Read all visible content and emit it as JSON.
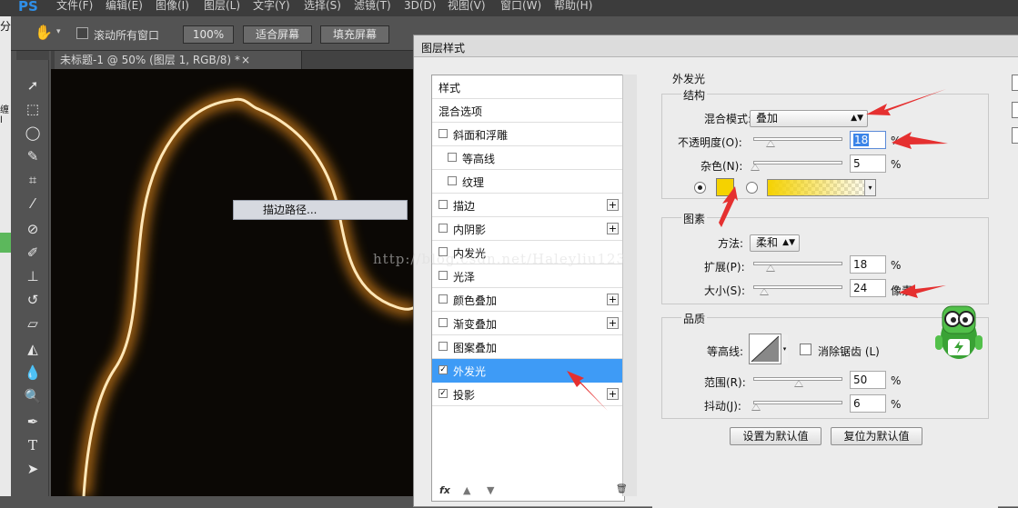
{
  "app": {
    "logo": "PS",
    "menus": [
      "文件(F)",
      "编辑(E)",
      "图像(I)",
      "图层(L)",
      "文字(Y)",
      "选择(S)",
      "滤镜(T)",
      "3D(D)",
      "视图(V)",
      "窗口(W)",
      "帮助(H)"
    ]
  },
  "left_edge": {
    "top_char": "分",
    "mid_text": "缠l"
  },
  "options_bar": {
    "scroll_all_label": "滚动所有窗口",
    "zoom_value": "100%",
    "fit_screen": "适合屏幕",
    "fill_screen": "填充屏幕"
  },
  "document": {
    "tab_title": "未标题-1 @ 50% (图层 1, RGB/8) *",
    "tab_close": "×"
  },
  "context_menu": {
    "item": "描边路径..."
  },
  "dialog": {
    "title": "图层样式",
    "style_list": [
      {
        "label": "样式",
        "checkbox": false,
        "plus": false,
        "indent": 0,
        "checked": false,
        "selected": false
      },
      {
        "label": "混合选项",
        "checkbox": false,
        "plus": false,
        "indent": 0,
        "checked": false,
        "selected": false
      },
      {
        "label": "斜面和浮雕",
        "checkbox": true,
        "plus": false,
        "indent": 0,
        "checked": false,
        "selected": false
      },
      {
        "label": "等高线",
        "checkbox": true,
        "plus": false,
        "indent": 1,
        "checked": false,
        "selected": false
      },
      {
        "label": "纹理",
        "checkbox": true,
        "plus": false,
        "indent": 1,
        "checked": false,
        "selected": false
      },
      {
        "label": "描边",
        "checkbox": true,
        "plus": true,
        "indent": 0,
        "checked": false,
        "selected": false
      },
      {
        "label": "内阴影",
        "checkbox": true,
        "plus": true,
        "indent": 0,
        "checked": false,
        "selected": false
      },
      {
        "label": "内发光",
        "checkbox": true,
        "plus": false,
        "indent": 0,
        "checked": false,
        "selected": false
      },
      {
        "label": "光泽",
        "checkbox": true,
        "plus": false,
        "indent": 0,
        "checked": false,
        "selected": false
      },
      {
        "label": "颜色叠加",
        "checkbox": true,
        "plus": true,
        "indent": 0,
        "checked": false,
        "selected": false
      },
      {
        "label": "渐变叠加",
        "checkbox": true,
        "plus": true,
        "indent": 0,
        "checked": false,
        "selected": false
      },
      {
        "label": "图案叠加",
        "checkbox": true,
        "plus": false,
        "indent": 0,
        "checked": false,
        "selected": false
      },
      {
        "label": "外发光",
        "checkbox": true,
        "plus": false,
        "indent": 0,
        "checked": true,
        "selected": true
      },
      {
        "label": "投影",
        "checkbox": true,
        "plus": true,
        "indent": 0,
        "checked": true,
        "selected": false
      }
    ],
    "list_footer": {
      "fx": "fx",
      "trash": "🗑"
    },
    "panel": {
      "title": "外发光",
      "structure": {
        "legend": "结构",
        "blend_mode_label": "混合模式:",
        "blend_mode_value": "叠加",
        "opacity_label": "不透明度(O):",
        "opacity_value": "18",
        "noise_label": "杂色(N):",
        "noise_value": "5",
        "percent": "%",
        "glow_color": "#f5d200",
        "color_selected": true
      },
      "elements": {
        "legend": "图素",
        "method_label": "方法:",
        "method_value": "柔和",
        "spread_label": "扩展(P):",
        "spread_value": "18",
        "size_label": "大小(S):",
        "size_value": "24",
        "size_unit": "像素",
        "percent": "%"
      },
      "quality": {
        "legend": "品质",
        "contour_label": "等高线:",
        "anti_alias_label": "消除锯齿 (L)",
        "anti_alias_checked": false,
        "range_label": "范围(R):",
        "range_value": "50",
        "jitter_label": "抖动(J):",
        "jitter_value": "6",
        "percent": "%"
      },
      "buttons": {
        "make_default": "设置为默认值",
        "reset_default": "复位为默认值"
      }
    }
  },
  "watermark": "http://blog.csdn.net/Haleyliu123",
  "colors": {
    "selection_blue": "#3e9bf6",
    "annotation_red": "#e53030",
    "glow_yellow": "#f5d200"
  }
}
